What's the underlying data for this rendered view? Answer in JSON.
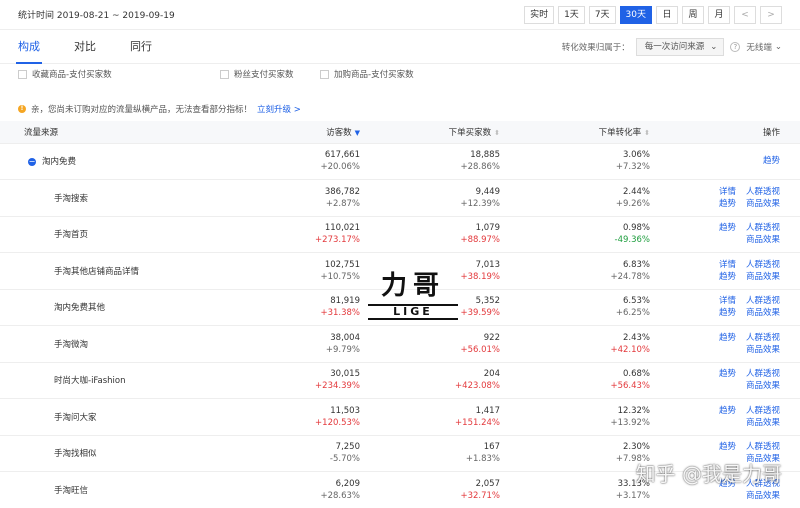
{
  "header": {
    "period": "统计时间 2019-08-21 ~ 2019-09-19",
    "ranges": [
      "实时",
      "1天",
      "7天",
      "30天",
      "日",
      "周",
      "月"
    ],
    "active_range": "30天",
    "prev": "<",
    "next": ">"
  },
  "tabs": [
    "构成",
    "对比",
    "同行"
  ],
  "attribution": {
    "label": "转化效果归属于：",
    "selected": "每一次访问来源",
    "help": "?",
    "nowire": "无线端"
  },
  "checkboxes": [
    "收藏商品-支付买家数",
    "粉丝支付买家数",
    "加购商品-支付买家数"
  ],
  "notice": {
    "text": "亲，您尚未订购对应的流量纵横产品，无法查看部分指标！",
    "link": "立刻升级 >"
  },
  "table": {
    "headers": [
      "流量来源",
      "访客数",
      "下单买家数",
      "下单转化率",
      "操作"
    ],
    "rows": [
      {
        "name": "淘内免费",
        "visitors": "617,661",
        "visitors_chg": "+20.06%",
        "buyers": "18,885",
        "buyers_chg": "+28.86%",
        "rate": "3.06%",
        "rate_chg": "+7.32%",
        "a1": "趋势",
        "a2": "",
        "a3": "",
        "a4": ""
      },
      {
        "name": "手淘搜索",
        "visitors": "386,782",
        "visitors_chg": "+2.87%",
        "buyers": "9,449",
        "buyers_chg": "+12.39%",
        "rate": "2.44%",
        "rate_chg": "+9.26%",
        "a1": "详情",
        "a2": "趋势",
        "a3": "人群透视",
        "a4": "商品效果"
      },
      {
        "name": "手淘首页",
        "visitors": "110,021",
        "visitors_chg": "+273.17%",
        "buyers": "1,079",
        "buyers_chg": "+88.97%",
        "rate": "0.98%",
        "rate_chg": "-49.36%",
        "a1": "",
        "a2": "趋势",
        "a3": "人群透视",
        "a4": "商品效果"
      },
      {
        "name": "手淘其他店铺商品详情",
        "visitors": "102,751",
        "visitors_chg": "+10.75%",
        "buyers": "7,013",
        "buyers_chg": "+38.19%",
        "rate": "6.83%",
        "rate_chg": "+24.78%",
        "a1": "详情",
        "a2": "趋势",
        "a3": "人群透视",
        "a4": "商品效果"
      },
      {
        "name": "淘内免费其他",
        "visitors": "81,919",
        "visitors_chg": "+31.38%",
        "buyers": "5,352",
        "buyers_chg": "+39.59%",
        "rate": "6.53%",
        "rate_chg": "+6.25%",
        "a1": "详情",
        "a2": "趋势",
        "a3": "人群透视",
        "a4": "商品效果"
      },
      {
        "name": "手淘微淘",
        "visitors": "38,004",
        "visitors_chg": "+9.79%",
        "buyers": "922",
        "buyers_chg": "+56.01%",
        "rate": "2.43%",
        "rate_chg": "+42.10%",
        "a1": "",
        "a2": "趋势",
        "a3": "人群透视",
        "a4": "商品效果"
      },
      {
        "name": "时尚大咖-iFashion",
        "visitors": "30,015",
        "visitors_chg": "+234.39%",
        "buyers": "204",
        "buyers_chg": "+423.08%",
        "rate": "0.68%",
        "rate_chg": "+56.43%",
        "a1": "",
        "a2": "趋势",
        "a3": "人群透视",
        "a4": "商品效果"
      },
      {
        "name": "手淘问大家",
        "visitors": "11,503",
        "visitors_chg": "+120.53%",
        "buyers": "1,417",
        "buyers_chg": "+151.24%",
        "rate": "12.32%",
        "rate_chg": "+13.92%",
        "a1": "",
        "a2": "趋势",
        "a3": "人群透视",
        "a4": "商品效果"
      },
      {
        "name": "手淘找相似",
        "visitors": "7,250",
        "visitors_chg": "-5.70%",
        "buyers": "167",
        "buyers_chg": "+1.83%",
        "rate": "2.30%",
        "rate_chg": "+7.98%",
        "a1": "",
        "a2": "趋势",
        "a3": "人群透视",
        "a4": "商品效果"
      },
      {
        "name": "手淘旺信",
        "visitors": "6,209",
        "visitors_chg": "+28.63%",
        "buyers": "2,057",
        "buyers_chg": "+32.71%",
        "rate": "33.13%",
        "rate_chg": "+3.17%",
        "a1": "",
        "a2": "趋势",
        "a3": "人群透视",
        "a4": "商品效果"
      }
    ]
  },
  "watermark": {
    "big": "力哥",
    "small": "LIGE",
    "corner": "知乎 @我是力哥"
  },
  "colors": {
    "accent": "#2062e6",
    "up": "#e3393c",
    "down": "#1e9e3e",
    "neutral": "#666666"
  }
}
